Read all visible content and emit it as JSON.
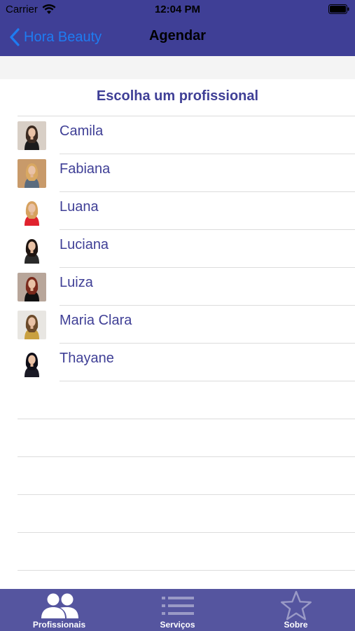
{
  "status_bar": {
    "carrier": "Carrier",
    "time": "12:04 PM"
  },
  "nav": {
    "back_label": "Hora Beauty",
    "title": "Agendar"
  },
  "main": {
    "heading": "Escolha um profissional",
    "professionals": [
      {
        "name": "Camila",
        "avatar_bg": "#d8cfc6",
        "hair": "#3b2a20",
        "top": "#1b1b1b"
      },
      {
        "name": "Fabiana",
        "avatar_bg": "#c89a6a",
        "hair": "#d9a862",
        "top": "#5a6b7e"
      },
      {
        "name": "Luana",
        "avatar_bg": "#ffffff",
        "hair": "#d6a15e",
        "top": "#e0222e"
      },
      {
        "name": "Luciana",
        "avatar_bg": "#ffffff",
        "hair": "#1e1410",
        "top": "#2a2a2a"
      },
      {
        "name": "Luiza",
        "avatar_bg": "#b8a69a",
        "hair": "#7a2a1c",
        "top": "#111111"
      },
      {
        "name": "Maria Clara",
        "avatar_bg": "#e8e6e2",
        "hair": "#6b4a2a",
        "top": "#c9a040"
      },
      {
        "name": "Thayane",
        "avatar_bg": "#ffffff",
        "hair": "#0e0e18",
        "top": "#1a1a26"
      }
    ]
  },
  "tabbar": {
    "tabs": [
      {
        "label": "Profissionais",
        "icon": "people-icon",
        "active": true
      },
      {
        "label": "Serviços",
        "icon": "list-icon",
        "active": false
      },
      {
        "label": "Sobre",
        "icon": "star-icon",
        "active": false
      }
    ]
  },
  "colors": {
    "brand": "#3f3f96",
    "tabbar": "#55559f",
    "link": "#1e7cf2"
  }
}
